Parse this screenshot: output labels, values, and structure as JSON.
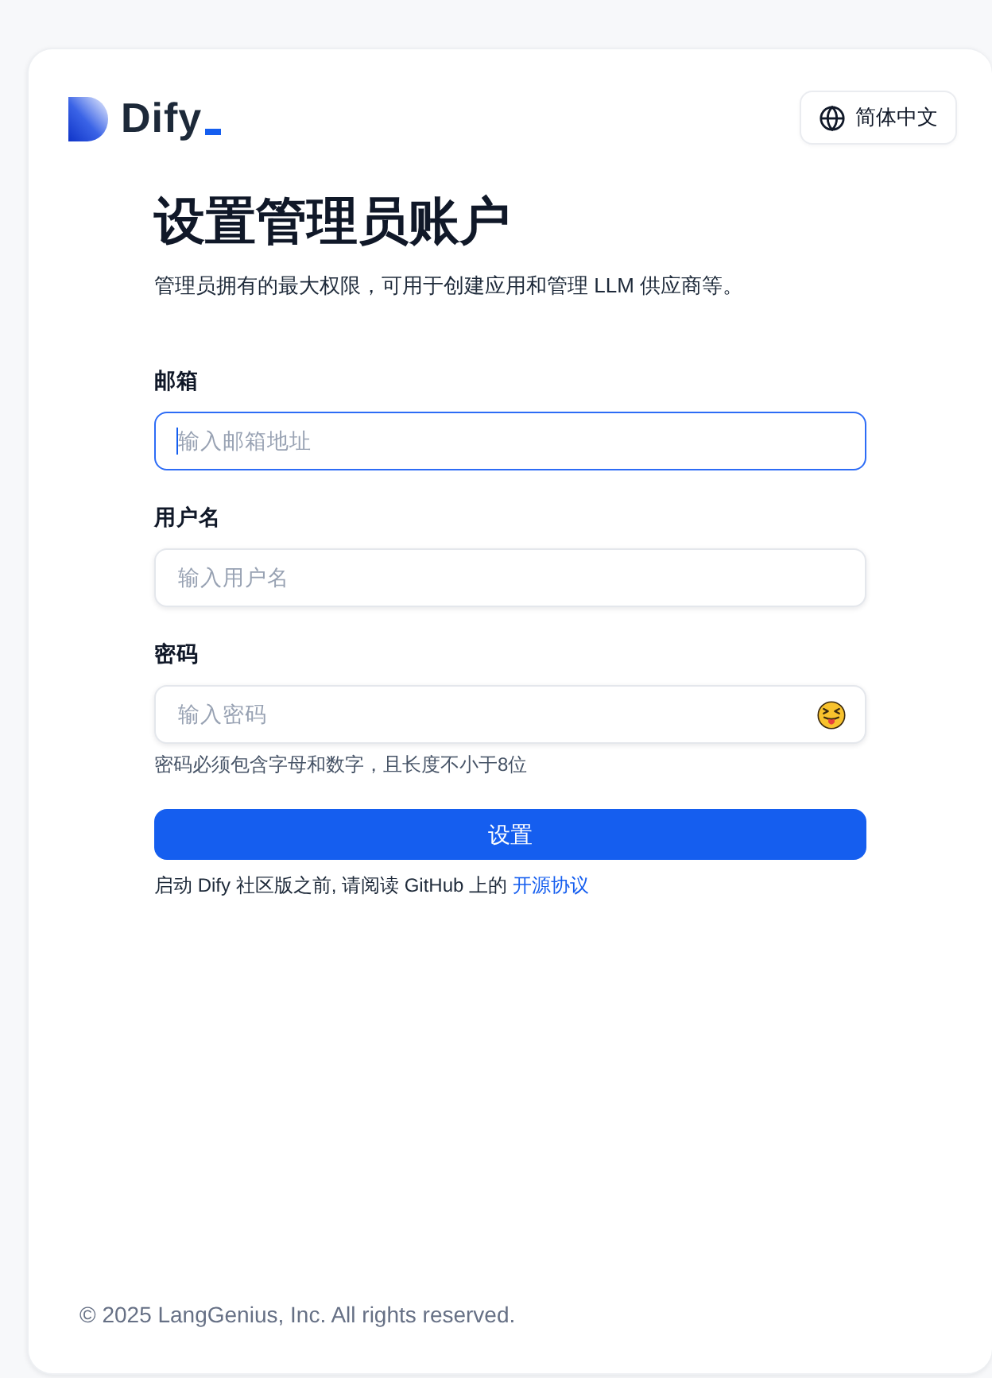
{
  "header": {
    "logo_text": "Dify",
    "language_button": "简体中文"
  },
  "form": {
    "title": "设置管理员账户",
    "subtitle": "管理员拥有的最大权限，可用于创建应用和管理 LLM 供应商等。",
    "fields": [
      {
        "kind": "text",
        "label": "邮箱",
        "placeholder": "输入邮箱地址",
        "focused": true
      },
      {
        "kind": "text",
        "label": "用户名",
        "placeholder": "输入用户名",
        "focused": false
      },
      {
        "kind": "password",
        "label": "密码",
        "placeholder": "输入密码",
        "focused": false,
        "hint": "密码必须包含字母和数字，且长度不小于8位"
      }
    ],
    "submit_button": "设置",
    "notice": {
      "text": "启动 Dify 社区版之前, 请阅读 GitHub 上的",
      "link": "开源协议"
    }
  },
  "footer": {
    "copyright": "© 2025 LangGenius, Inc. All rights reserved."
  }
}
